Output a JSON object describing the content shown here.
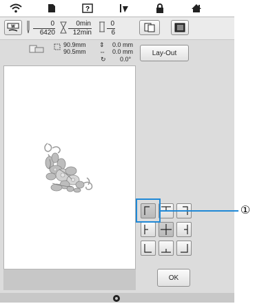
{
  "topbar": {
    "icons": [
      "wifi-icon",
      "page-icon",
      "help-icon",
      "thread-icon",
      "lock-icon",
      "home-icon"
    ],
    "glyphs": [
      "◔",
      "■",
      "?",
      "✥",
      "▲",
      "⌂"
    ]
  },
  "status": {
    "color_change_top": "0",
    "color_change_bottom": "6420",
    "time_top": "0min",
    "time_bottom": "12min",
    "stitch_top": "0",
    "stitch_bottom": "6"
  },
  "info": {
    "width_value": "90.9mm",
    "height_value": "90.5mm",
    "offset_v": "0.0 mm",
    "offset_h": "0.0 mm",
    "rotation": "0.0°"
  },
  "layout_button": "Lay-Out",
  "ok_button": "OK",
  "callout": "①"
}
